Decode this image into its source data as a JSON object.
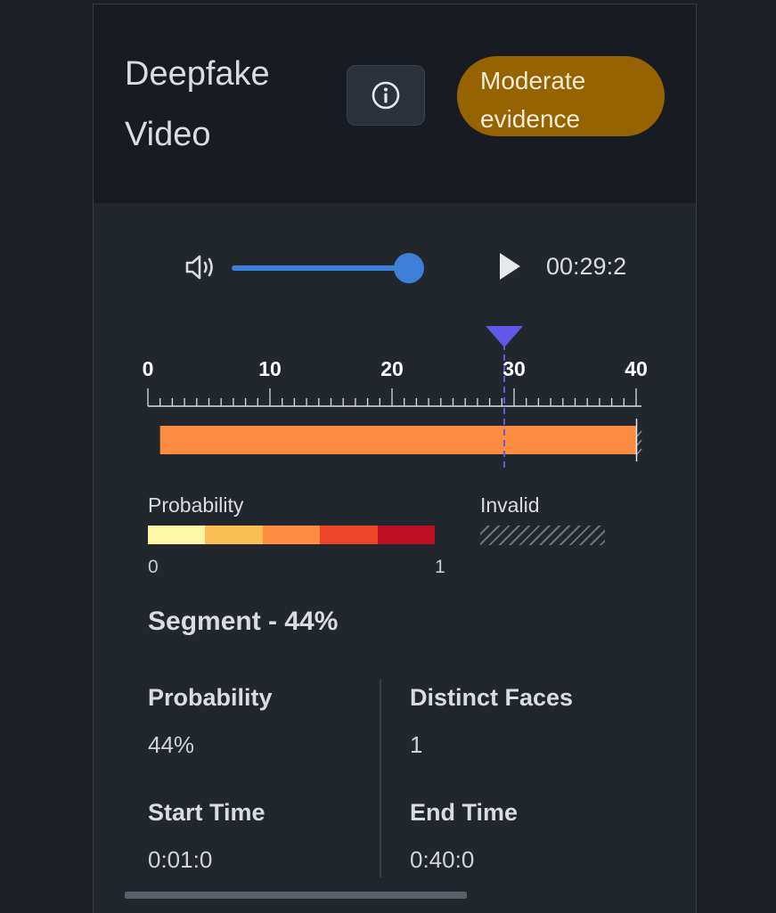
{
  "header": {
    "title": "Deepfake\nVideo",
    "badge_label": "Moderate\nevidence",
    "badge_color": "#956400",
    "info_icon": "info-icon"
  },
  "player": {
    "volume_icon": "volume-icon",
    "volume_level": 0.92,
    "play_icon": "play-icon",
    "time": "00:29:2"
  },
  "timeline": {
    "axis_min": 0,
    "axis_max": 40,
    "ticks": [
      "0",
      "10",
      "20",
      "30",
      "40"
    ],
    "playhead": 29.2,
    "segment": {
      "start": 1,
      "end": 40,
      "color": "#fd8c40"
    },
    "invalid_from": 40
  },
  "legend": {
    "probability_label": "Probability",
    "min_label": "0",
    "max_label": "1",
    "colors": [
      "#fef7a6",
      "#fdbf55",
      "#fd8c40",
      "#ed4425",
      "#be0f25"
    ],
    "invalid_label": "Invalid"
  },
  "segment": {
    "title": "Segment - 44%",
    "probability_label": "Probability",
    "probability_value": "44%",
    "faces_label": "Distinct Faces",
    "faces_value": "1",
    "start_label": "Start Time",
    "start_value": "0:01:0",
    "end_label": "End Time",
    "end_value": "0:40:0"
  }
}
